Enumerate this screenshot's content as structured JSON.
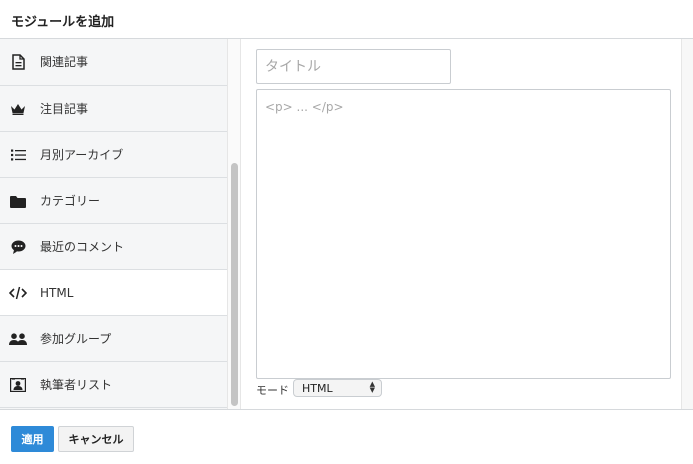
{
  "dialog": {
    "title": "モジュールを追加"
  },
  "sidebar": {
    "items": [
      {
        "label": "関連記事",
        "icon": "document-icon"
      },
      {
        "label": "注目記事",
        "icon": "crown-icon"
      },
      {
        "label": "月別アーカイブ",
        "icon": "list-icon"
      },
      {
        "label": "カテゴリー",
        "icon": "folder-icon"
      },
      {
        "label": "最近のコメント",
        "icon": "comment-icon"
      },
      {
        "label": "HTML",
        "icon": "code-icon",
        "active": true
      },
      {
        "label": "参加グループ",
        "icon": "group-icon"
      },
      {
        "label": "執筆者リスト",
        "icon": "author-icon"
      }
    ]
  },
  "editor": {
    "title_placeholder": "タイトル",
    "title_value": "",
    "content_placeholder": "<p> ... </p>",
    "content_value": "",
    "mode_label": "モード",
    "mode_value": "HTML"
  },
  "footer": {
    "apply_label": "適用",
    "cancel_label": "キャンセル"
  },
  "colors": {
    "accent": "#2e8ad8",
    "sidebar_bg": "#f5f6f7",
    "active_item_bg": "#ffffff"
  }
}
